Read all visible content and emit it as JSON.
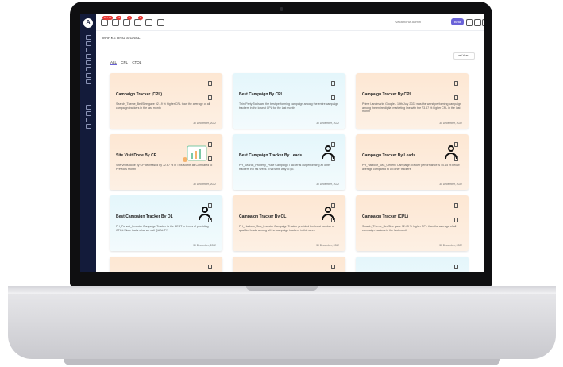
{
  "app": {
    "logo_letter": "A",
    "page_title": "MARKETING SIGNAL",
    "partner_label": "Vacathonia Admin",
    "top_button": "Beta",
    "badges": [
      "10 / 40",
      "12",
      "8",
      "2"
    ]
  },
  "tabs": [
    "ALL",
    "CPL",
    "CTQL"
  ],
  "filter_label": "Last Year",
  "cards": [
    {
      "title": "Campaign Tracker (CPL)",
      "text": "Search_Theme_BedSize gave 92.19 % higher CPL than the average of all campaign trackers in the last month",
      "date": "30 December, 2022",
      "color": "orange",
      "illustration": "none"
    },
    {
      "title": "Best Campaign By CPL",
      "text": "ThirdParty Tools are the best performing campaign among the entire campaign trackers in the lowest CPL for the last month",
      "date": "30 December, 2022",
      "color": "blue",
      "illustration": "none"
    },
    {
      "title": "Campaign Tracker By CPL",
      "text": "Prime Landmarks Google - 19th July 2022 was the worst performing campaign among the entire digital marketing line with the 73.67 % higher CPL in the last month",
      "date": "30 December, 2022",
      "color": "orange",
      "illustration": "none"
    },
    {
      "title": "Site Visit Done By CP",
      "text": "Site Visits done by CP decreased by 72.67 % in This Month as Compared to Previous Month",
      "date": "30 December, 2022",
      "color": "orange",
      "illustration": "chart-illustration"
    },
    {
      "title": "Best Campaign Tracker By Leads",
      "text": "PH_Search_Property_Pune Campaign Tracker is outperforming all other trackers in This Week. That's the way to go.",
      "date": "30 December, 2022",
      "color": "blue",
      "illustration": "person-icon"
    },
    {
      "title": "Campaign Tracker By Leads",
      "text": "PH_Harbour_Sea_Generic Campaign Tracker performance is 40.15 % below average compared to all other trackers",
      "date": "30 December, 2022",
      "color": "orange",
      "illustration": "person-icon"
    },
    {
      "title": "Best Campaign Tracker By QL",
      "text": "PH_Parvati_Investor Campaign Tracker is the BEST in terms of providing CTQL! Now that's what we call QUALITY",
      "date": "30 December, 2022",
      "color": "blue",
      "illustration": "person-icon"
    },
    {
      "title": "Campaign Tracker By QL",
      "text": "PH_Harbour_Sea_Investor Campaign Tracker provided the least number of qualified leads among all the campaign trackers in this week",
      "date": "30 December, 2022",
      "color": "orange",
      "illustration": "person-icon"
    },
    {
      "title": "Campaign Tracker (CPL)",
      "text": "Search_Theme_BedSize gave 92.43 % higher CPL than the average of all campaign trackers in the last month",
      "date": "30 December, 2022",
      "color": "orange",
      "illustration": "none"
    },
    {
      "title": "",
      "text": "",
      "date": "",
      "color": "orange",
      "illustration": "none"
    },
    {
      "title": "",
      "text": "",
      "date": "",
      "color": "orange",
      "illustration": "none"
    },
    {
      "title": "",
      "text": "",
      "date": "",
      "color": "blue",
      "illustration": "none"
    }
  ]
}
